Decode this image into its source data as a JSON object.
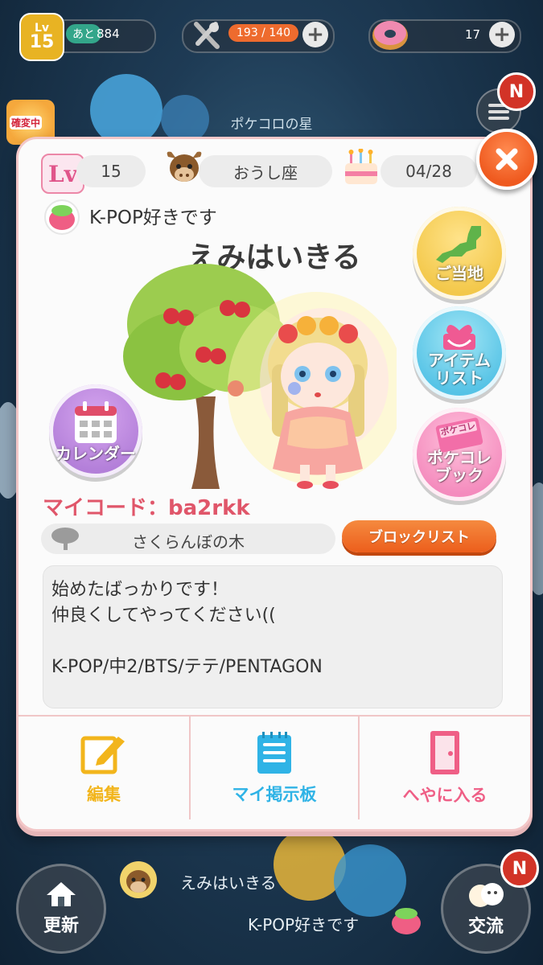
{
  "status_bar": {
    "level_label": "Lv",
    "level_value": "15",
    "exp_prefix": "あと",
    "exp_value": "884",
    "stamina_value": "193 / 140",
    "donut_value": "17"
  },
  "badge_letter": "N",
  "planet_name": "ポケコロの星",
  "event_tag": "確変中",
  "profile": {
    "level_icon_text": "Lv",
    "level": "15",
    "zodiac": "おうし座",
    "birthday": "04/28",
    "status_message": "K-POP好きです",
    "user_name": "えみはいきる",
    "my_code": "マイコード：ba2rkk",
    "room_name": "さくらんぼの木",
    "block_list_label": "ブロックリスト",
    "bio_lines": [
      "始めたばっかりです！",
      "仲良くしてやってください((",
      "",
      "K-POP/中2/BTS/テテ/PENTAGON"
    ]
  },
  "side_buttons": {
    "calendar": "カレンダー",
    "local": "ご当地",
    "item_list": "アイテム\nリスト",
    "pokekore_book": "ポケコレ\nブック"
  },
  "book_stamp": "ポケコレ",
  "actions": {
    "edit": "編集",
    "board": "マイ掲示板",
    "enter_room": "へやに入る"
  },
  "bottom_nav": {
    "refresh": "更新",
    "exchange": "交流",
    "feed_name": "えみはいきる",
    "feed_status": "K-POP好きです"
  },
  "colors": {
    "dialog_border": "#f3c7c8",
    "my_code": "#e0566a",
    "edit": "#f2b51c",
    "board": "#2fb3e6",
    "enter_room": "#ef5f86",
    "block_button": "#f06a24",
    "close_button": "#ef5a1f"
  }
}
